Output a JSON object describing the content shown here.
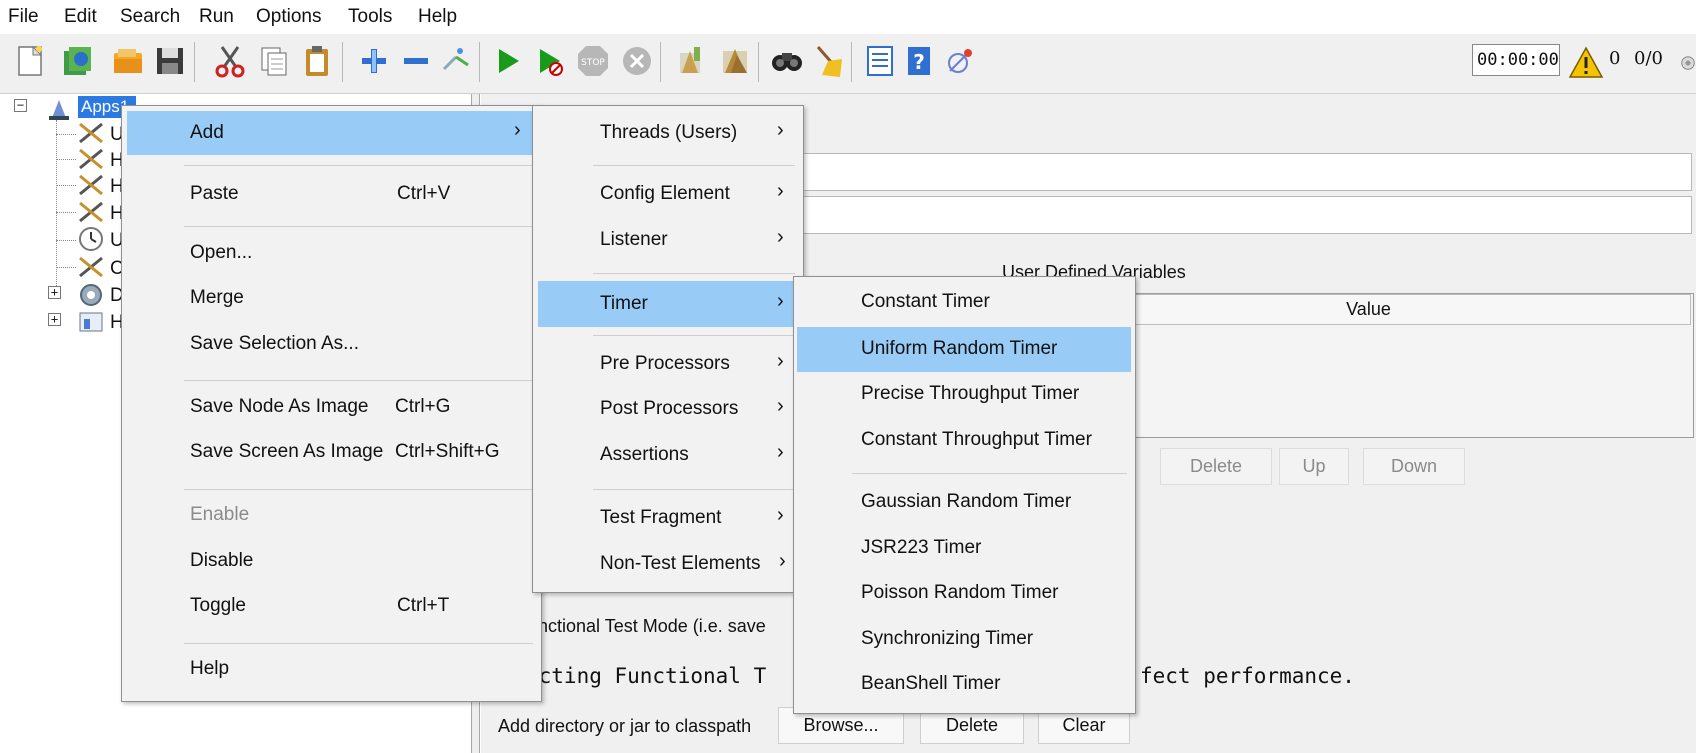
{
  "menubar": [
    "File",
    "Edit",
    "Search",
    "Run",
    "Options",
    "Tools",
    "Help"
  ],
  "toolbar": {
    "timer": "00:00:00",
    "warning_count": "0",
    "threads": "0/0"
  },
  "tree": {
    "root_label": "Apps1",
    "child_letters": [
      "U",
      "H",
      "H",
      "H",
      "U",
      "C",
      "D",
      "H"
    ]
  },
  "context_menu": {
    "items": [
      {
        "label": "Add",
        "shortcut": "",
        "submenu": true,
        "highlighted": true
      },
      {
        "label": "Paste",
        "shortcut": "Ctrl+V"
      },
      {
        "label": "Open...",
        "shortcut": ""
      },
      {
        "label": "Merge",
        "shortcut": ""
      },
      {
        "label": "Save Selection As...",
        "shortcut": ""
      },
      {
        "label": "Save Node As Image",
        "shortcut": "Ctrl+G"
      },
      {
        "label": "Save Screen As Image",
        "shortcut": "Ctrl+Shift+G"
      },
      {
        "label": "Enable",
        "shortcut": "",
        "disabled": true
      },
      {
        "label": "Disable",
        "shortcut": ""
      },
      {
        "label": "Toggle",
        "shortcut": "Ctrl+T"
      },
      {
        "label": "Help",
        "shortcut": ""
      }
    ]
  },
  "add_submenu": {
    "items": [
      {
        "label": "Threads (Users)"
      },
      {
        "label": "Config Element"
      },
      {
        "label": "Listener"
      },
      {
        "label": "Timer",
        "highlighted": true
      },
      {
        "label": "Pre Processors"
      },
      {
        "label": "Post Processors"
      },
      {
        "label": "Assertions"
      },
      {
        "label": "Test Fragment"
      },
      {
        "label": "Non-Test Elements"
      }
    ]
  },
  "timer_submenu": {
    "items": [
      {
        "label": "Constant Timer"
      },
      {
        "label": "Uniform Random Timer",
        "highlighted": true
      },
      {
        "label": "Precise Throughput Timer"
      },
      {
        "label": "Constant Throughput Timer"
      },
      {
        "label": "Gaussian Random Timer"
      },
      {
        "label": "JSR223 Timer"
      },
      {
        "label": "Poisson Random Timer"
      },
      {
        "label": "Synchronizing Timer"
      },
      {
        "label": "BeanShell Timer"
      }
    ]
  },
  "right_pane": {
    "udv_title": "User Defined Variables",
    "value_header": "Value",
    "buttons": {
      "delete": "Delete",
      "up": "Up",
      "down": "Down"
    },
    "functional_text": "unctional Test Mode (i.e. save",
    "mono_text": "ecting Functional T",
    "mono_text_right": "fect performance.",
    "classpath_label": "Add directory or jar to classpath",
    "classpath_buttons": {
      "browse": "Browse...",
      "delete": "Delete",
      "clear": "Clear"
    }
  },
  "colors": {
    "menu_highlight": "#99cbf7",
    "tree_selection": "#2a7ae2",
    "run_green": "#1a9a1a"
  }
}
